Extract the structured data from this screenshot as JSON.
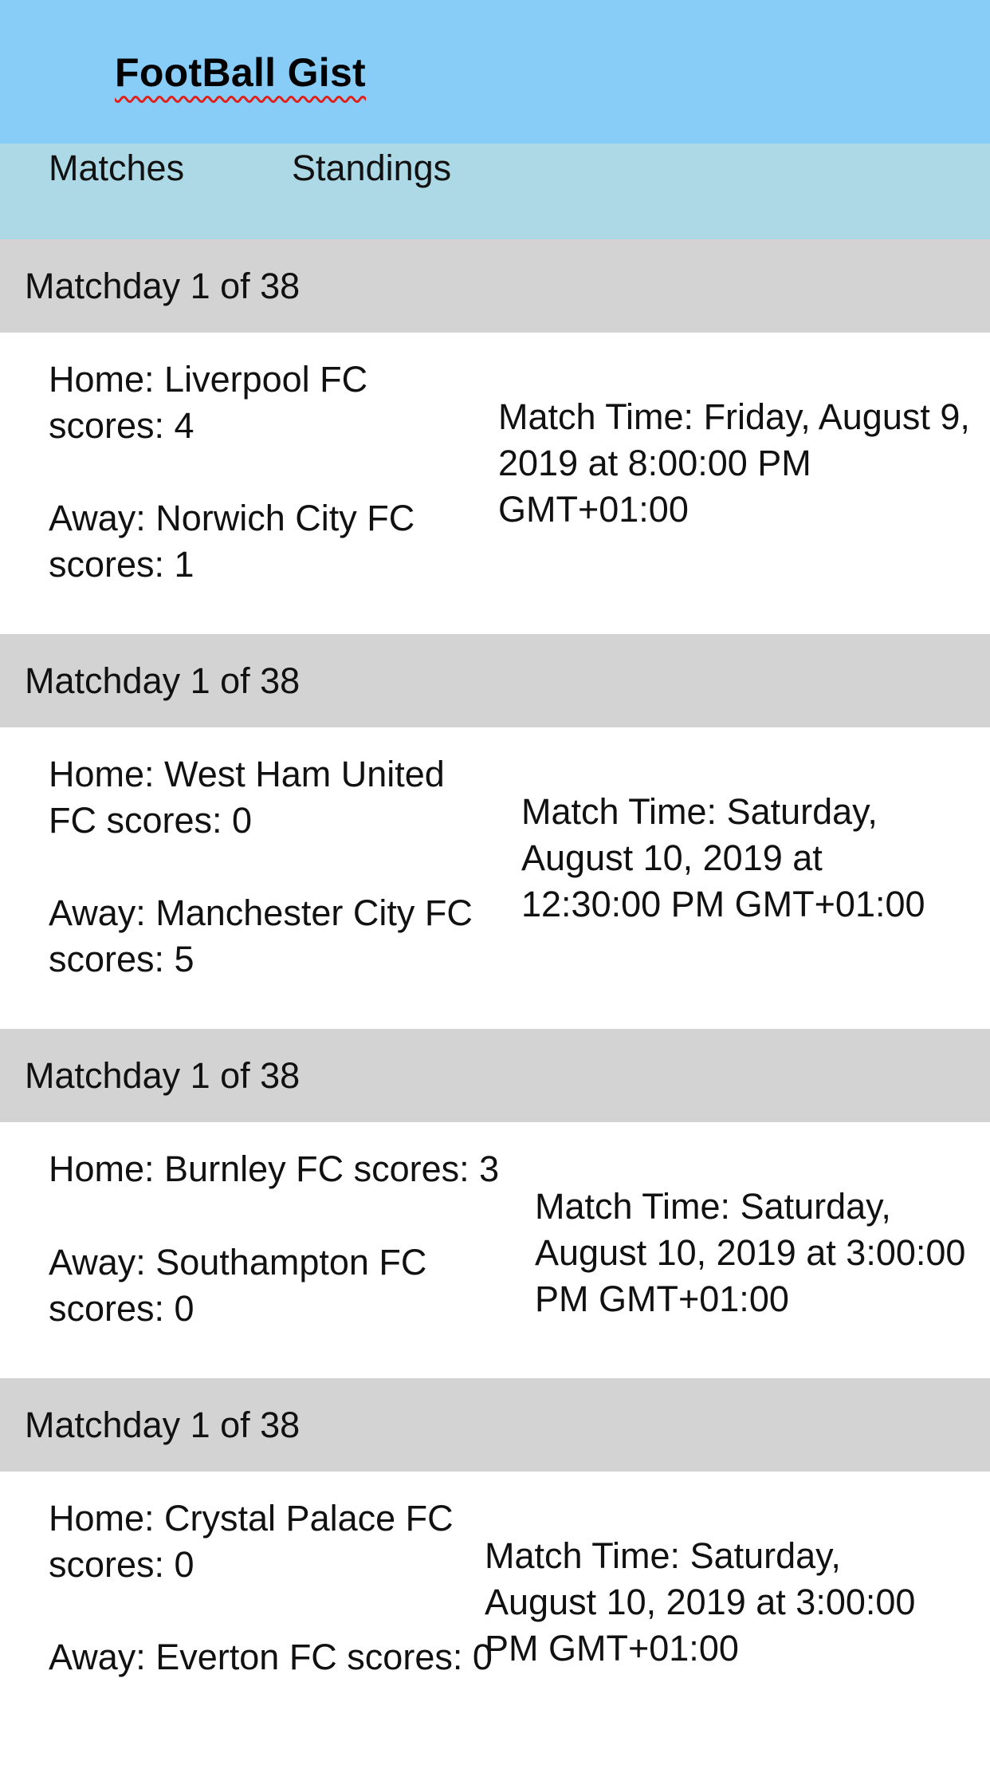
{
  "app": {
    "title": "FootBall Gist"
  },
  "nav": {
    "matches": "Matches",
    "standings": "Standings"
  },
  "matches": [
    {
      "matchday": "Matchday 1 of 38",
      "home": "Home: Liverpool FC scores: 4",
      "away": "Away: Norwich City FC scores: 1",
      "time": "Match Time: Friday, August 9, 2019 at 8:00:00 PM GMT+01:00"
    },
    {
      "matchday": "Matchday 1 of 38",
      "home": "Home: West Ham United FC scores: 0",
      "away": "Away: Manchester City FC scores: 5",
      "time": "Match Time: Saturday, August 10, 2019 at 12:30:00 PM GMT+01:00"
    },
    {
      "matchday": "Matchday 1 of 38",
      "home": "Home: Burnley FC scores: 3",
      "away": "Away: Southampton FC scores: 0",
      "time": "Match Time: Saturday, August 10, 2019 at 3:00:00 PM GMT+01:00"
    },
    {
      "matchday": "Matchday 1 of 38",
      "home": "Home: Crystal Palace FC scores: 0",
      "away": "Away: Everton FC scores: 0",
      "time": "Match Time: Saturday, August 10, 2019 at 3:00:00 PM GMT+01:00"
    }
  ]
}
